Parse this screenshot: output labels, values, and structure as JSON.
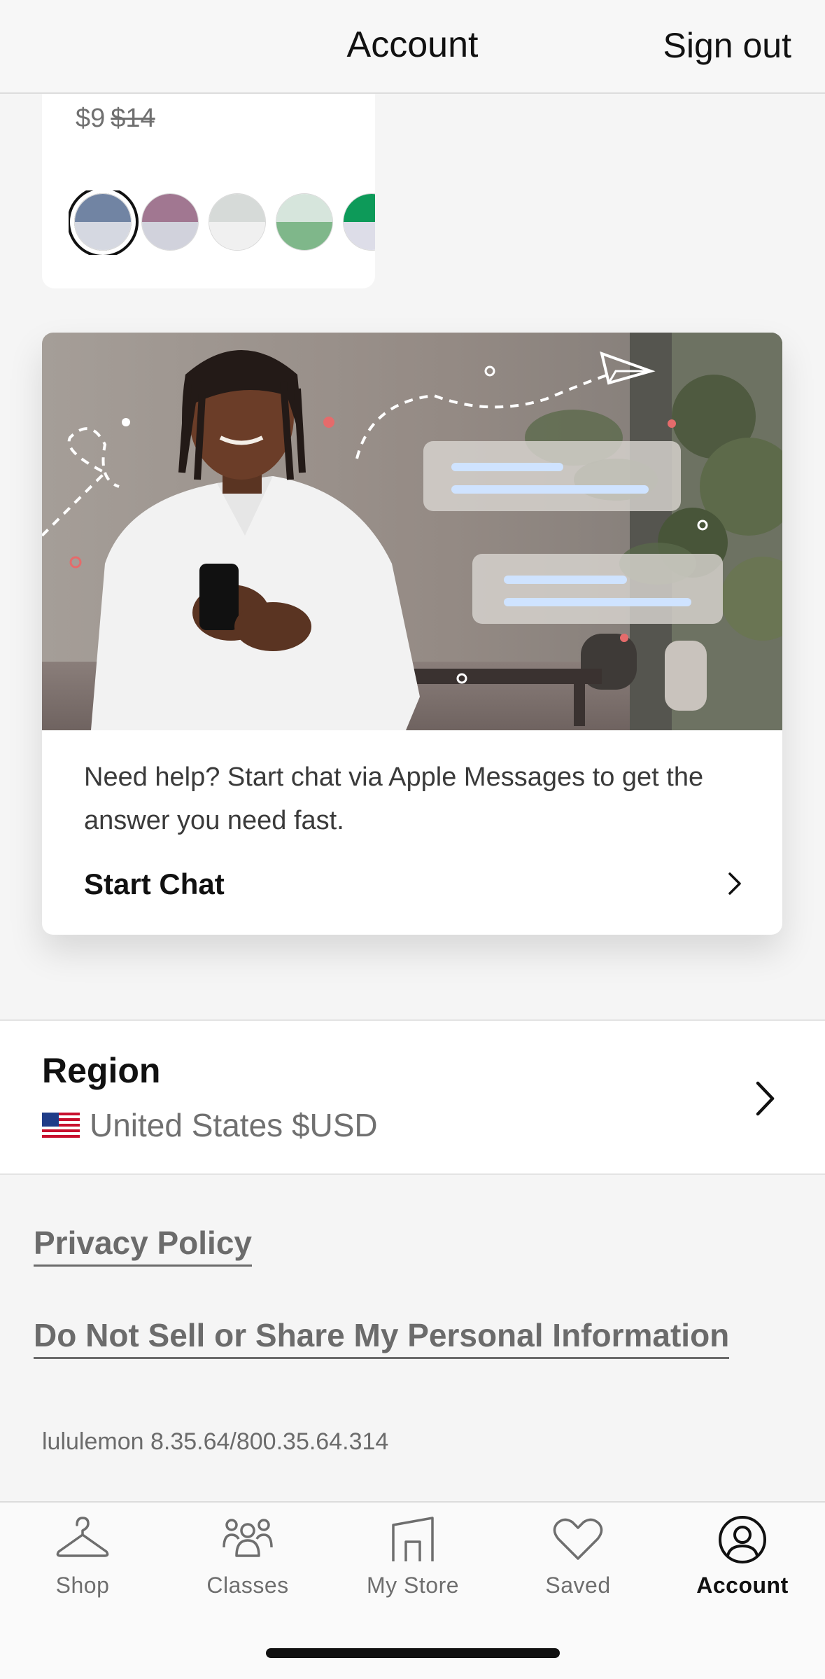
{
  "header": {
    "title": "Account",
    "sign_out": "Sign out"
  },
  "product": {
    "price_sale": "$9",
    "price_original": "$14",
    "swatches": [
      {
        "top": "#7184a3",
        "bottom": "#d5d8e1",
        "selected": true
      },
      {
        "top": "#a17791",
        "bottom": "#d1d2dc",
        "selected": false
      },
      {
        "top": "#d6dad8",
        "bottom": "#f0f0f0",
        "selected": false
      },
      {
        "top": "#d6e5dc",
        "bottom": "#7fb78a",
        "selected": false
      },
      {
        "top": "#0d9a59",
        "bottom": "#dddde8",
        "selected": false
      }
    ]
  },
  "help": {
    "description": "Need help? Start chat via Apple Messages to get the answer you need fast.",
    "cta": "Start Chat"
  },
  "region": {
    "title": "Region",
    "value": "United States $USD",
    "flag": "us-flag"
  },
  "links": {
    "privacy": "Privacy Policy",
    "do_not_sell": "Do Not Sell or Share My Personal Information"
  },
  "version": "lululemon 8.35.64/800.35.64.314",
  "tabs": [
    {
      "label": "Shop",
      "icon": "hanger-icon",
      "active": false
    },
    {
      "label": "Classes",
      "icon": "people-icon",
      "active": false
    },
    {
      "label": "My Store",
      "icon": "store-icon",
      "active": false
    },
    {
      "label": "Saved",
      "icon": "heart-icon",
      "active": false
    },
    {
      "label": "Account",
      "icon": "user-circle-icon",
      "active": true
    }
  ],
  "colors": {
    "accent": "#111111",
    "muted": "#707070",
    "background": "#f5f5f5"
  }
}
